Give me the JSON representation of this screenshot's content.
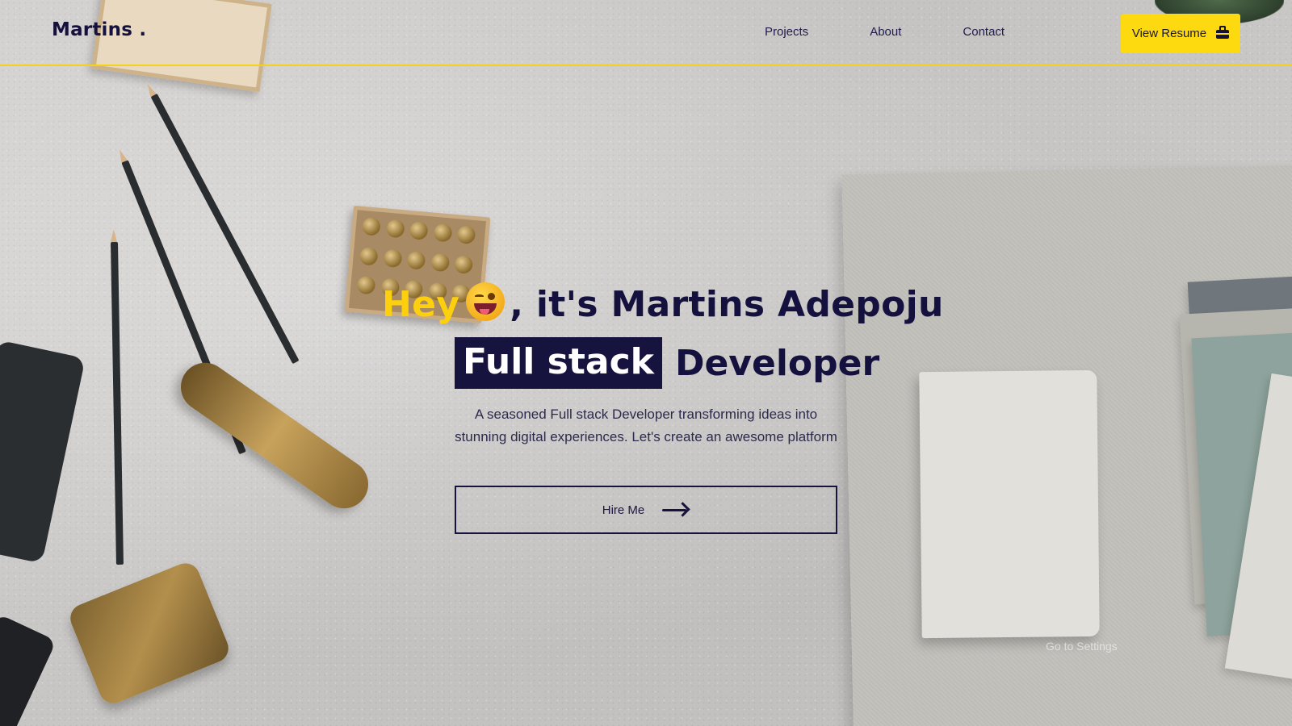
{
  "header": {
    "logo": "Martins",
    "logo_dot": ".",
    "nav": [
      {
        "label": "Projects"
      },
      {
        "label": "About"
      },
      {
        "label": "Contact"
      }
    ],
    "resume_button": {
      "label": "View Resume",
      "icon": "briefcase-icon"
    }
  },
  "hero": {
    "greeting": "Hey",
    "greeting_emoji_icon": "winking-tongue-face-icon",
    "intro_rest": ", it's Martins Adepoju",
    "role_highlight": "Full stack",
    "role_rest": "Developer",
    "description": "A seasoned Full stack Developer transforming ideas into stunning digital experiences. Let's create an awesome platform",
    "hire_button": {
      "label": "Hire Me",
      "icon": "arrow-right-icon"
    }
  },
  "overlay": {
    "watermark_text": "Go to Settings"
  },
  "colors": {
    "accent_yellow": "#fdd90f",
    "navy": "#15113f"
  }
}
